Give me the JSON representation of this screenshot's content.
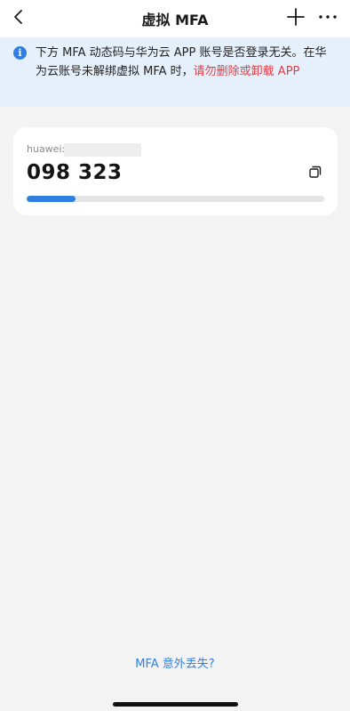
{
  "header": {
    "title": "虚拟 MFA",
    "back_icon": "chevron-left-icon",
    "add_icon": "plus-icon",
    "more_icon": "more-horizontal-icon"
  },
  "notice": {
    "icon": "info-icon",
    "icon_glyph": "i",
    "text": "下方 MFA 动态码与华为云 APP 账号是否登录无关。在华为云账号未解绑虚拟 MFA 时，",
    "warning": "请勿删除或卸载 APP"
  },
  "card": {
    "account_label": "huawei:",
    "code": "098 323",
    "copy_icon": "copy-icon",
    "progress_fraction": 0.165
  },
  "footer": {
    "link_label": "MFA 意外丢失?"
  },
  "colors": {
    "accent": "#2f7fe2",
    "warning": "#e53c45",
    "notice_bg": "#e6f0fb",
    "page_bg": "#f3f3f3"
  }
}
